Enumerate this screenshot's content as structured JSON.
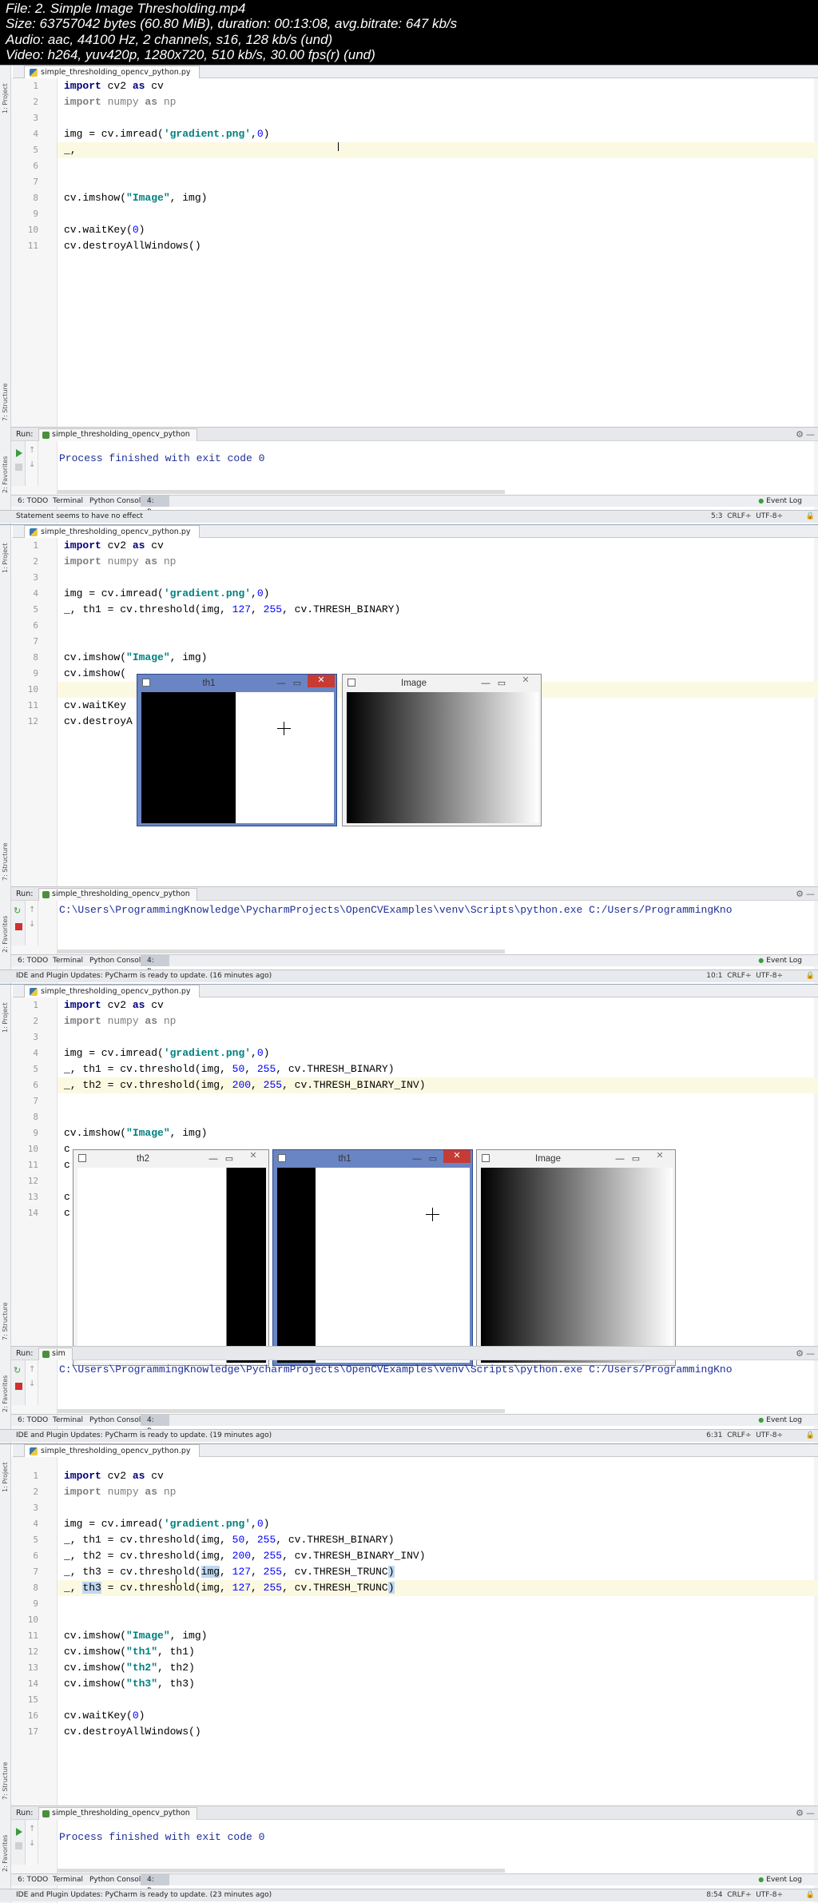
{
  "header": {
    "line1": "File: 2. Simple Image Thresholding.mp4",
    "line2": "Size: 63757042 bytes (60.80 MiB), duration: 00:13:08, avg.bitrate: 647 kb/s",
    "line3": "Audio: aac, 44100 Hz, 2 channels, s16, 128 kb/s (und)",
    "line4": "Video: h264, yuv420p, 1280x720, 510 kb/s, 30.00 fps(r) (und)"
  },
  "ui": {
    "file_tab": "simple_thresholding_opencv_python.py",
    "run_label": "Run:",
    "run_tab": "simple_thresholding_opencv_python",
    "run_tab_short": "sim",
    "side_project": "1: Project",
    "side_structure": "7: Structure",
    "side_favorites": "2: Favorites",
    "bottom_todo": "6: TODO",
    "bottom_terminal": "Terminal",
    "bottom_console": "Python Console",
    "bottom_run": "4: Run",
    "event_log": "Event Log",
    "encoding": "UTF-8",
    "line_sep": "CRLF",
    "process_finished": "Process finished with exit code 0",
    "python_cmd": "C:\\Users\\ProgrammingKnowledge\\PycharmProjects\\OpenCVExamples\\venv\\Scripts\\python.exe C:/Users/ProgrammingKno"
  },
  "frames": [
    {
      "status_msg": "Statement seems to have no effect",
      "caret": "5:3",
      "code": {
        "l1a": "import",
        "l1b": " cv2 ",
        "l1c": "as",
        "l1d": " cv",
        "l2a": "import",
        "l2b": " numpy ",
        "l2c": "as",
        "l2d": " np",
        "l4a": "img = cv.imread(",
        "l4b": "'gradient.png'",
        "l4c": ",",
        "l4d": "0",
        "l4e": ")",
        "l5": "_,",
        "l8a": "cv.imshow(",
        "l8b": "\"Image\"",
        "l8c": ", img)",
        "l10a": "cv.waitKey(",
        "l10b": "0",
        "l10c": ")",
        "l11": "cv.destroyAllWindows()"
      }
    },
    {
      "status_msg": "IDE and Plugin Updates: PyCharm is ready to update. (16 minutes ago)",
      "caret": "10:1",
      "code": {
        "l5a": "_, th1 = cv.threshold(img, ",
        "l5b": "127",
        "l5c": ", ",
        "l5d": "255",
        "l5e": ", cv.THRESH_BINARY)",
        "l9": "cv.imshow(",
        "l11": "cv.waitKey",
        "l12": "cv.destroyA"
      },
      "windows": {
        "th1": "th1",
        "image": "Image"
      }
    },
    {
      "status_msg": "IDE and Plugin Updates: PyCharm is ready to update. (19 minutes ago)",
      "caret": "6:31",
      "code": {
        "l5a": "_, th1 = cv.threshold(img, ",
        "l5b": "50",
        "l5c": ", ",
        "l5d": "255",
        "l5e": ", cv.THRESH_BINARY)",
        "l6a": "_, th2 = cv.threshold(img, ",
        "l6b": "200",
        "l6c": ", ",
        "l6d": "255",
        "l6e": ", cv.THRESH_BINARY_INV)",
        "l10": "c",
        "l11": "c",
        "l13": "c",
        "l14": "c"
      },
      "windows": {
        "th2": "th2",
        "th1": "th1",
        "image": "Image"
      }
    },
    {
      "status_msg": "IDE and Plugin Updates: PyCharm is ready to update. (23 minutes ago)",
      "caret": "8:54",
      "code": {
        "l7a": "_, th3 = cv.threshold(",
        "l7b": "img",
        "l7c": ", ",
        "l7d": "127",
        "l7e": ", ",
        "l7f": "255",
        "l7g": ", cv.THRESH_TRUNC",
        "l7h": ")",
        "l8a": "_, ",
        "l8b": "th3",
        "l8c": " = cv.threshold(img, ",
        "l8d": "127",
        "l8e": ", ",
        "l8f": "255",
        "l8g": ", cv.THRESH_TRUNC",
        "l8h": ")",
        "l12a": "cv.imshow(",
        "l12b": "\"th1\"",
        "l12c": ", th1)",
        "l13a": "cv.imshow(",
        "l13b": "\"th2\"",
        "l13c": ", th2)",
        "l14a": "cv.imshow(",
        "l14b": "\"th3\"",
        "l14c": ", th3)"
      }
    }
  ],
  "colors": {
    "keyword": "#000080",
    "string": "#008080",
    "number": "#0000ff",
    "output": "#1e2e98",
    "active_window": "#6a85c3"
  }
}
